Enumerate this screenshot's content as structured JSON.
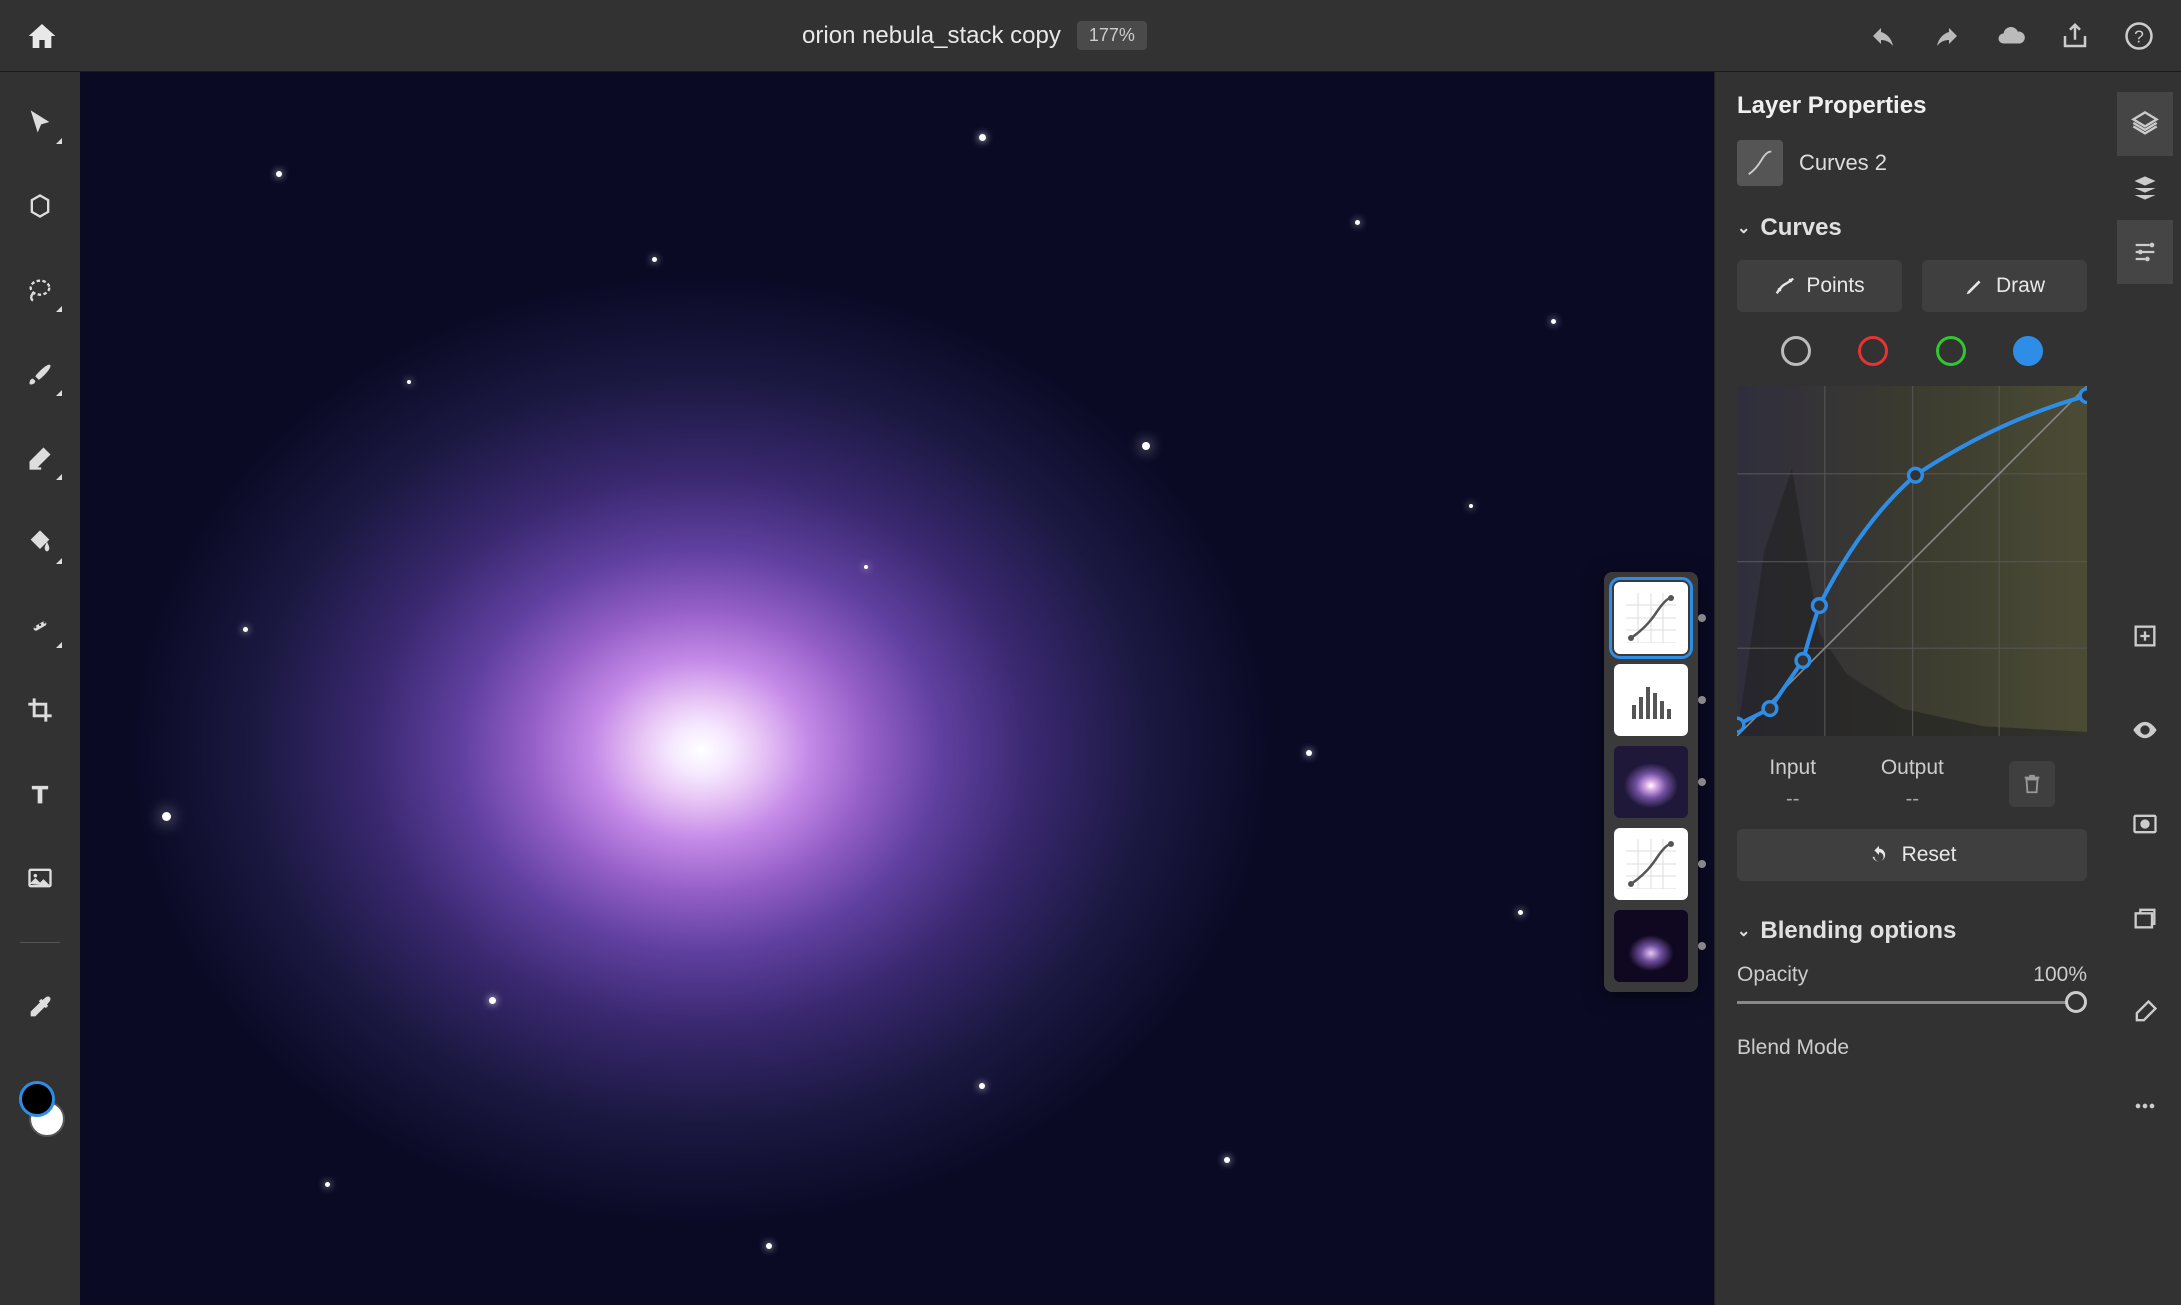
{
  "header": {
    "document_title": "orion nebula_stack copy",
    "zoom": "177%"
  },
  "panel": {
    "title": "Layer Properties",
    "layer_name": "Curves 2",
    "curves_section": "Curves",
    "points_btn": "Points",
    "draw_btn": "Draw",
    "input_label": "Input",
    "output_label": "Output",
    "input_val": "--",
    "output_val": "--",
    "reset_btn": "Reset",
    "blending_section": "Blending options",
    "opacity_label": "Opacity",
    "opacity_value": "100%",
    "blend_mode_label": "Blend Mode"
  },
  "chart_data": {
    "type": "line",
    "title": "Curves (Blue channel)",
    "xlabel": "Input",
    "ylabel": "Output",
    "xlim": [
      0,
      255
    ],
    "ylim": [
      0,
      255
    ],
    "active_channel": "blue",
    "identity_line": [
      [
        0,
        0
      ],
      [
        255,
        255
      ]
    ],
    "series": [
      {
        "name": "Blue channel curve",
        "color": "#2e8de6",
        "points": [
          [
            0,
            8
          ],
          [
            24,
            20
          ],
          [
            48,
            55
          ],
          [
            60,
            95
          ],
          [
            130,
            190
          ],
          [
            255,
            248
          ]
        ]
      }
    ]
  },
  "colors": {
    "accent": "#2e8de6",
    "bg": "#323232",
    "panel_bg": "#3f3f3f"
  }
}
